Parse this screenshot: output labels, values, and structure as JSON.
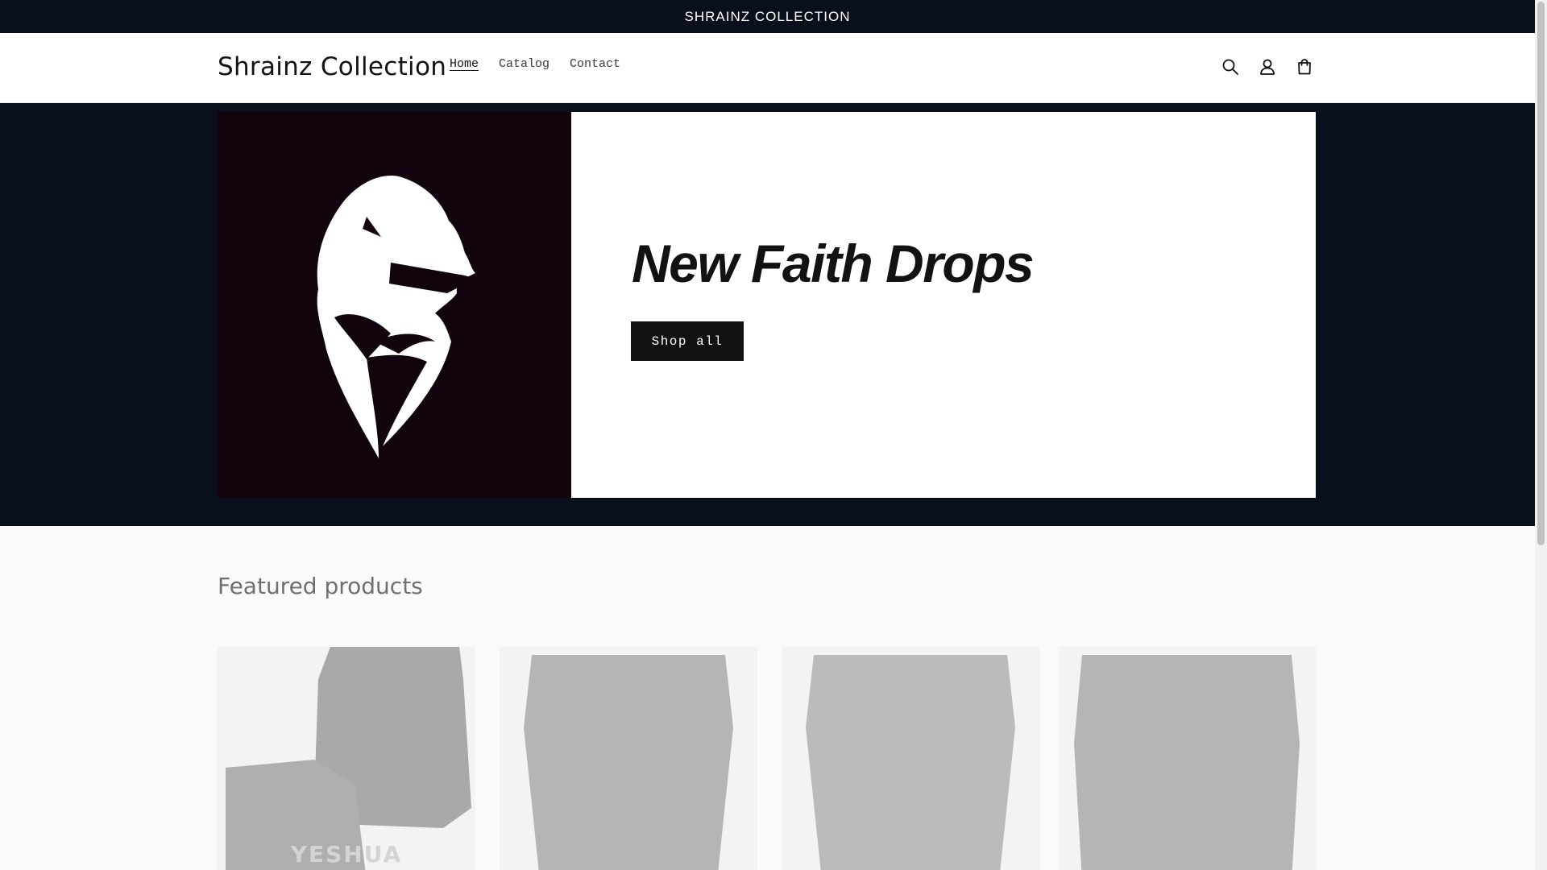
{
  "announcement": {
    "text": "SHRAINZ COLLECTION"
  },
  "header": {
    "logo": "Shrainz Collection",
    "nav": [
      {
        "label": "Home",
        "active": true
      },
      {
        "label": "Catalog",
        "active": false
      },
      {
        "label": "Contact",
        "active": false
      }
    ],
    "icons": [
      "search-icon",
      "account-icon",
      "cart-icon"
    ]
  },
  "hero": {
    "heading": "New Faith Drops",
    "button": "Shop all",
    "image": "lion-logo"
  },
  "featured": {
    "heading": "Featured products",
    "products": [
      {
        "visible_text": "YESHUA"
      },
      {
        "visible_text": ""
      },
      {
        "visible_text": ""
      },
      {
        "visible_text": ""
      }
    ]
  },
  "colors": {
    "dark_bg": "#0a0f1c",
    "hero_media_bg": "#12040f",
    "button_bg": "#121212"
  }
}
